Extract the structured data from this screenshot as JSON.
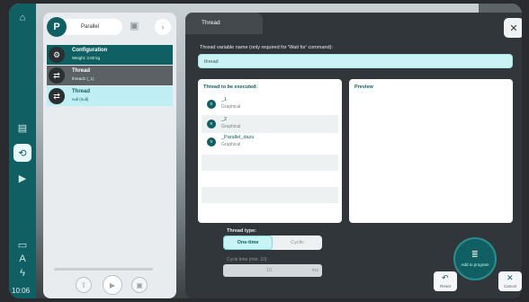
{
  "rail": {
    "time": "10:06"
  },
  "project": {
    "avatar_letter": "P",
    "name": "Parallel",
    "tree": [
      {
        "title": "Configuration",
        "sub": "Weight: 3.00 kg"
      },
      {
        "title": "Thread",
        "sub": "thread1 (_1)"
      },
      {
        "title": "Thread",
        "sub": "null (null)"
      }
    ]
  },
  "dialog": {
    "tab_label": "Thread",
    "var_label": "Thread variable name (only required for 'Wait for' command):",
    "var_value": "thread",
    "exec_title": "Thread to be executed:",
    "exec_items": [
      {
        "name": "_1",
        "type": "Graphical"
      },
      {
        "name": "_2",
        "type": "Graphical"
      },
      {
        "name": "_Parallel_dazu",
        "type": "Graphical"
      }
    ],
    "preview_title": "Preview",
    "type_label": "Thread type:",
    "type_options": [
      "One-time",
      "Cyclic"
    ],
    "cycle_label": "Cycle time (min. 10):",
    "cycle_value": "10",
    "cycle_unit": "ms",
    "add_label": "Add to program",
    "reset_label": "Reset",
    "cancel_label": "Cancel"
  },
  "colors": {
    "accent": "#0f5f63",
    "highlight": "#c9f3f4"
  }
}
